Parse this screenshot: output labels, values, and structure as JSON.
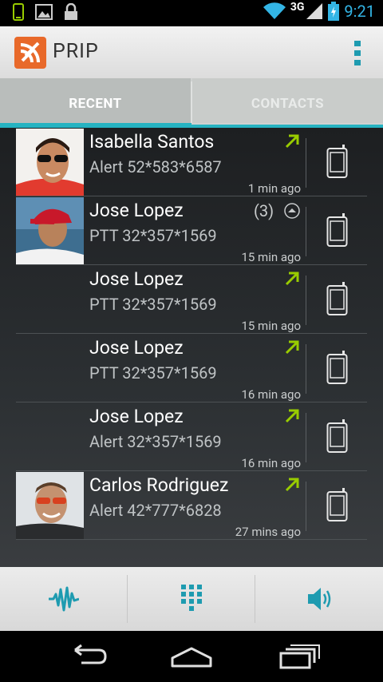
{
  "status_bar": {
    "network": "3G",
    "time": "9:21"
  },
  "app": {
    "title": "PRIP",
    "brand_color": "#e8692a",
    "accent_color": "#26b3c1"
  },
  "tabs": [
    {
      "label": "RECENT",
      "selected": true
    },
    {
      "label": "CONTACTS",
      "selected": false
    }
  ],
  "calls": [
    {
      "name": "Isabella Santos",
      "detail": "Alert 52*583*6587",
      "time": "1 min ago",
      "direction": "outgoing-arrow-icon",
      "avatar": "woman-sunglasses"
    },
    {
      "name": "Jose Lopez",
      "detail": "PTT 32*357*1569",
      "time": "15 min ago",
      "count": "(3)",
      "direction": "expand-up-icon",
      "avatar": "man-red-cap"
    },
    {
      "name": "Jose Lopez",
      "detail": "PTT 32*357*1569",
      "time": "15 min ago",
      "direction": "outgoing-arrow-icon"
    },
    {
      "name": "Jose Lopez",
      "detail": "PTT 32*357*1569",
      "time": "16 min ago",
      "direction": "outgoing-arrow-icon"
    },
    {
      "name": "Jose Lopez",
      "detail": "Alert 32*357*1569",
      "time": "16 min ago",
      "direction": "outgoing-arrow-icon"
    },
    {
      "name": "Carlos Rodriguez",
      "detail": "Alert 42*777*6828",
      "time": "27 mins ago",
      "direction": "outgoing-arrow-icon",
      "avatar": "man-red-sunglasses"
    }
  ],
  "bottom_actions": [
    "waveform-icon",
    "dialpad-icon",
    "speaker-icon"
  ],
  "nav_buttons": [
    "back-icon",
    "home-icon",
    "recent-apps-icon"
  ]
}
